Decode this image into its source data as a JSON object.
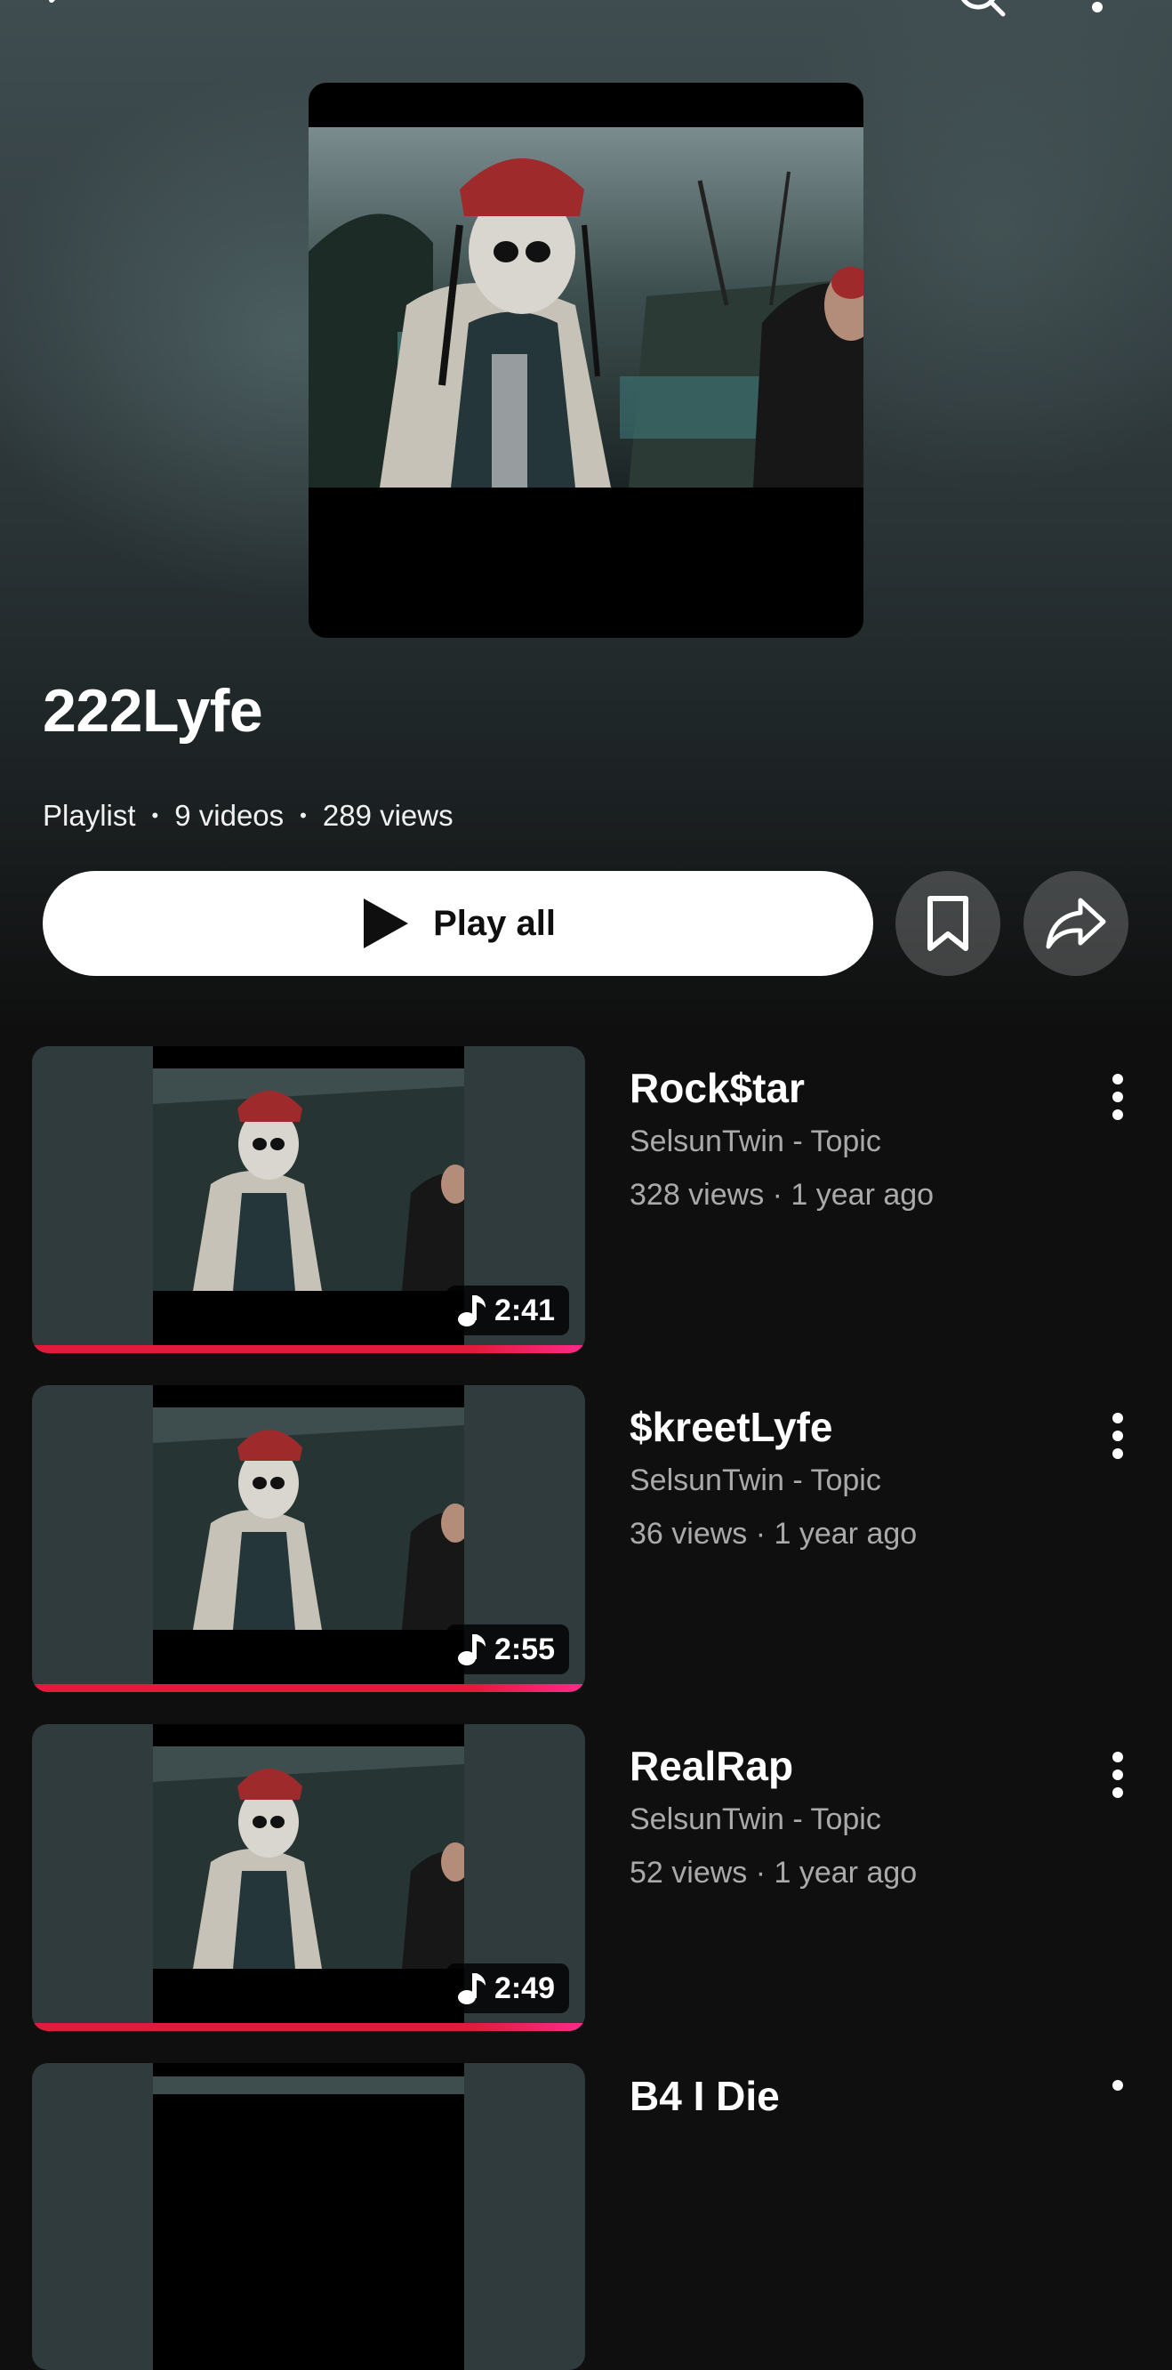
{
  "playlist": {
    "title": "222Lyfe",
    "type_label": "Playlist",
    "video_count": "9 videos",
    "views": "289 views"
  },
  "actions": {
    "play_all_label": "Play all"
  },
  "colors": {
    "progress": "#e21b3c",
    "background": "#0f0f0f",
    "thumb_bg": "#2f3b3d"
  },
  "videos": [
    {
      "title": "Rock$tar",
      "channel": "SelsunTwin - Topic",
      "stats": "328 views · 1 year ago",
      "duration": "2:41"
    },
    {
      "title": "$kreetLyfe",
      "channel": "SelsunTwin - Topic",
      "stats": "36 views · 1 year ago",
      "duration": "2:55"
    },
    {
      "title": "RealRap",
      "channel": "SelsunTwin - Topic",
      "stats": "52 views · 1 year ago",
      "duration": "2:49"
    },
    {
      "title": "B4 I Die"
    }
  ],
  "icons": [
    "back-icon",
    "search-icon",
    "more-vert-icon",
    "play-icon",
    "bookmark-icon",
    "share-icon",
    "music-note-icon"
  ]
}
